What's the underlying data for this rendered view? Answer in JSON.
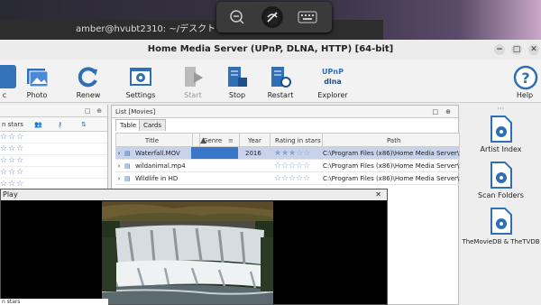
{
  "terminal": {
    "title": "amber@hvubt2310: ~/デスクトップ"
  },
  "window": {
    "title": "Home Media Server (UPnP, DLNA, HTTP) [64-bit]",
    "min": "−",
    "max": "□",
    "close": "✕"
  },
  "toolbar": {
    "photo": "Photo",
    "renew": "Renew",
    "settings": "Settings",
    "start": "Start",
    "stop": "Stop",
    "restart": "Restart",
    "explorer": "Explorer",
    "help": "Help",
    "explorer_top": "UPnP",
    "explorer_mid": "dlna",
    "cut": "c"
  },
  "left": {
    "col_stars": "n stars",
    "play_label": "Play",
    "stars_row": "☆☆☆",
    "bottom_label": "n stars"
  },
  "list": {
    "title": "List [Movies]",
    "tabs": [
      "Table",
      "Cards"
    ],
    "columns": {
      "title": "Title",
      "genre": "Genre",
      "year": "Year",
      "rating": "Rating in stars",
      "path": "Path"
    },
    "rows": [
      {
        "title": "Waterfall.MOV",
        "year": "2016",
        "rating": "★★★☆☆",
        "path": "C:\\Program Files (x86)\\Home Media Server\\Samp"
      },
      {
        "title": "wildanimal.mp4",
        "year": "",
        "rating": "☆☆☆☆☆",
        "path": "C:\\Program Files (x86)\\Home Media Server\\Samp"
      },
      {
        "title": "Wildlife in HD",
        "year": "",
        "rating": "☆☆☆☆☆",
        "path": "C:\\Program Files (x86)\\Home Media Server\\Samp"
      }
    ]
  },
  "right": {
    "dots": "···",
    "artist": "Artist Index",
    "scan": "Scan Folders",
    "tmdb": "TheMovieDB & TheTVDB"
  },
  "player": {
    "title": "Play",
    "close": "✕"
  },
  "colors": {
    "selected": "#c6d3ea",
    "accent": "#2e6fb5",
    "genre_bar": "#3a76c9"
  }
}
